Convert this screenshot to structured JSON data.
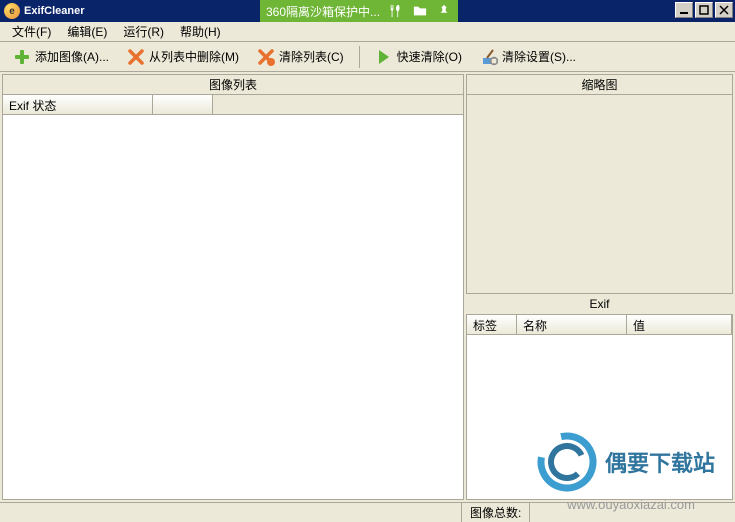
{
  "titlebar": {
    "app_icon_letter": "e",
    "title": "ExifCleaner",
    "sandbox_text": "360隔离沙箱保护中..."
  },
  "menubar": {
    "file": "文件(F)",
    "edit": "编辑(E)",
    "run": "运行(R)",
    "help": "帮助(H)"
  },
  "toolbar": {
    "add_image": "添加图像(A)...",
    "remove_from_list": "从列表中删除(M)",
    "clear_list": "清除列表(C)",
    "quick_clean": "快速清除(O)",
    "clean_settings": "清除设置(S)..."
  },
  "panes": {
    "image_list_title": "图像列表",
    "thumbnail_title": "缩略图",
    "exif_title": "Exif",
    "exif_status_col": "Exif 状态",
    "tag_col": "标签",
    "name_col": "名称",
    "value_col": "值"
  },
  "statusbar": {
    "image_count_label": "图像总数:"
  },
  "watermark": {
    "site_name": "偶要下载站",
    "url": "www.ouyaoxiazai.com"
  }
}
